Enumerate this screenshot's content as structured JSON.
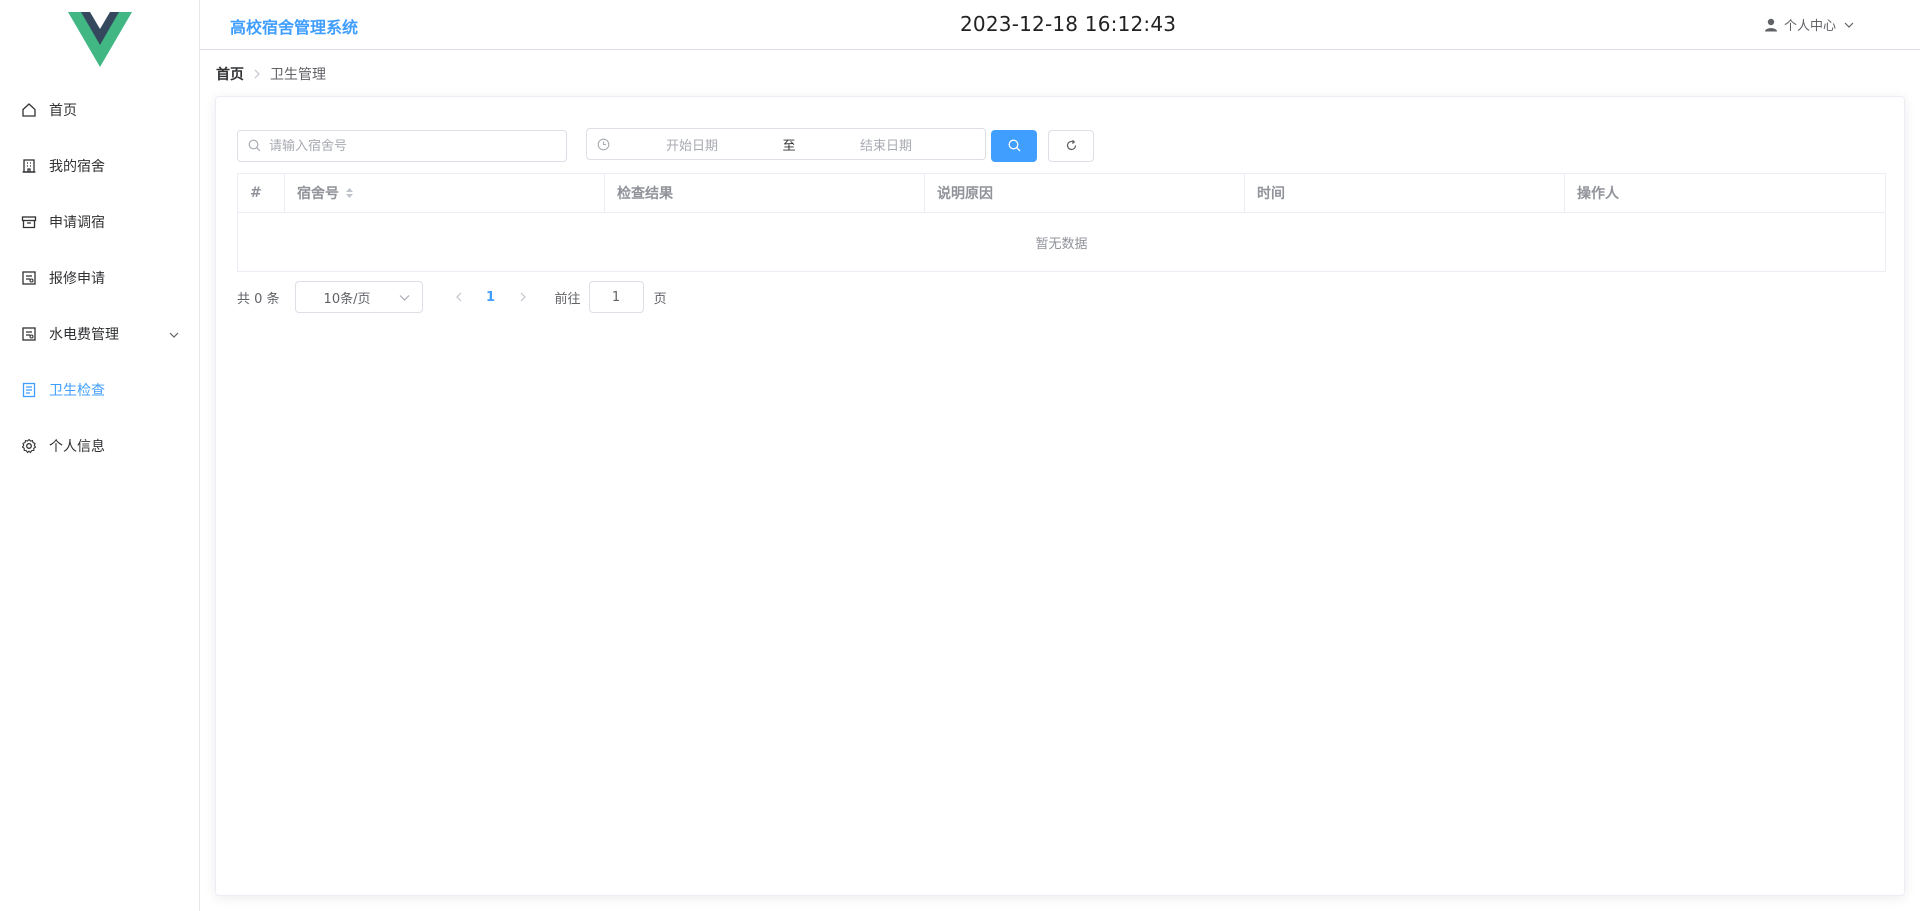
{
  "app": {
    "title": "高校宿舍管理系统",
    "datetime": "2023-12-18 16:12:43"
  },
  "colors": {
    "accent": "#409eff",
    "logo_outer": "#41b883",
    "logo_inner": "#34495e"
  },
  "sidebar": {
    "items": [
      {
        "label": "首页",
        "icon": "home-icon"
      },
      {
        "label": "我的宿舍",
        "icon": "building-icon"
      },
      {
        "label": "申请调宿",
        "icon": "box-icon"
      },
      {
        "label": "报修申请",
        "icon": "tickets-icon"
      },
      {
        "label": "水电费管理",
        "icon": "tickets-icon"
      },
      {
        "label": "卫生检查",
        "icon": "document-icon"
      },
      {
        "label": "个人信息",
        "icon": "gear-icon"
      }
    ]
  },
  "header": {
    "user_menu_label": "个人中心"
  },
  "breadcrumb": {
    "home": "首页",
    "current": "卫生管理"
  },
  "filters": {
    "search_placeholder": "请输入宿舍号",
    "start_date_placeholder": "开始日期",
    "range_separator": "至",
    "end_date_placeholder": "结束日期"
  },
  "table": {
    "columns": [
      "#",
      "宿舍号",
      "检查结果",
      "说明原因",
      "时间",
      "操作人"
    ],
    "empty_text": "暂无数据"
  },
  "pagination": {
    "total_label": "共 0 条",
    "page_size": "10条/页",
    "current_page": "1",
    "goto_label": "前往",
    "goto_value": "1",
    "page_unit": "页"
  }
}
